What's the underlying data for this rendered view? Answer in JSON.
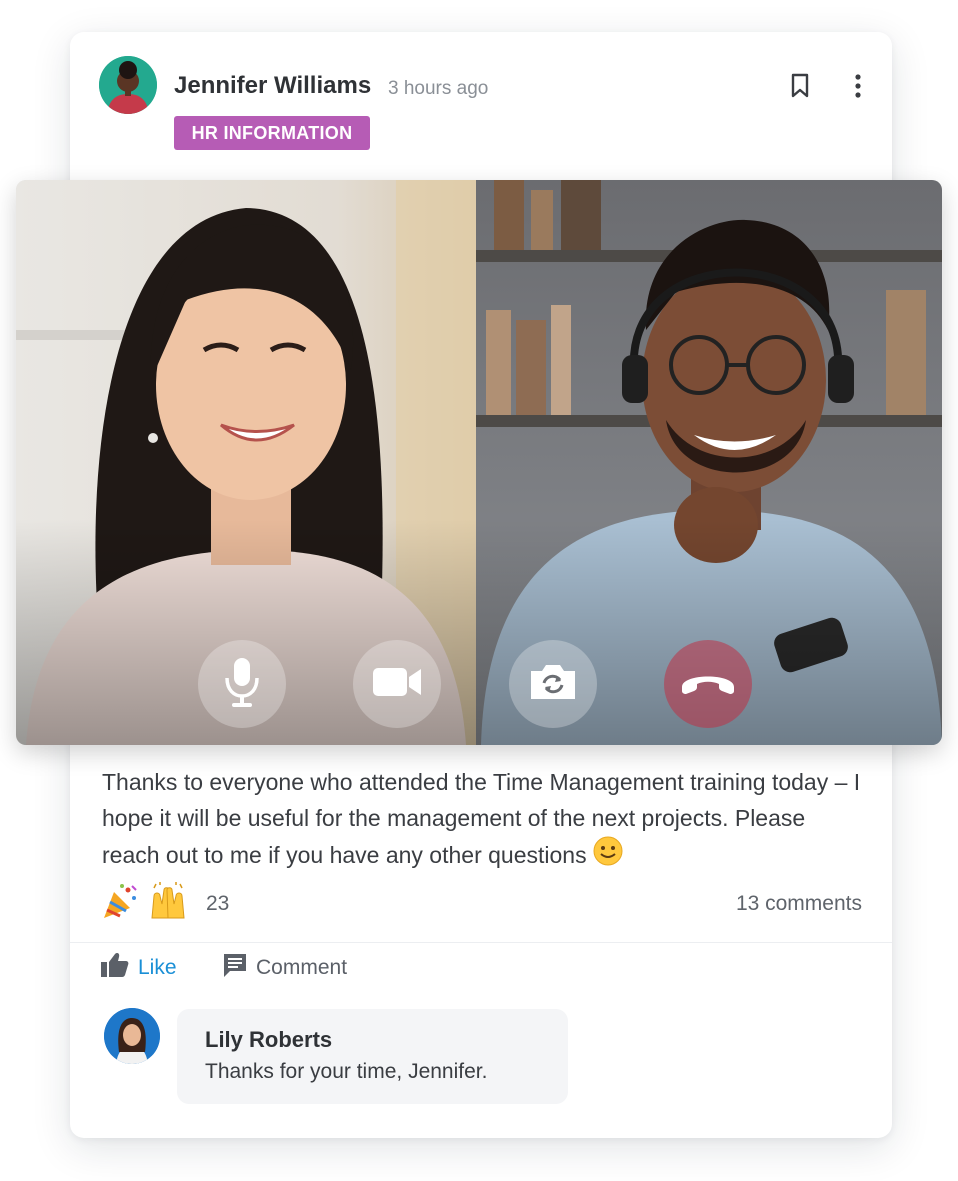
{
  "post": {
    "author": "Jennifer Williams",
    "time": "3 hours ago",
    "tag": "HR INFORMATION",
    "text": "Thanks to everyone who attended the Time Management training today – I hope it will be useful for the management of the next projects. Please reach out to me if you have any other questions",
    "reaction_count": "23",
    "comments_count": "13 comments",
    "colors": {
      "tag": "#b65cb5",
      "like": "#1a8fd6"
    }
  },
  "actions": {
    "like_label": "Like",
    "comment_label": "Comment"
  },
  "icons": {
    "bookmark": "bookmark-icon",
    "more": "more-vertical-icon",
    "mic": "microphone-icon",
    "camera": "video-camera-icon",
    "switch_camera": "switch-camera-icon",
    "end_call": "end-call-icon",
    "reactions": [
      "party-popper-emoji",
      "raising-hands-emoji"
    ],
    "smile": "smiling-face-emoji"
  },
  "comment": {
    "author": "Lily Roberts",
    "text": "Thanks for your time, Jennifer."
  }
}
